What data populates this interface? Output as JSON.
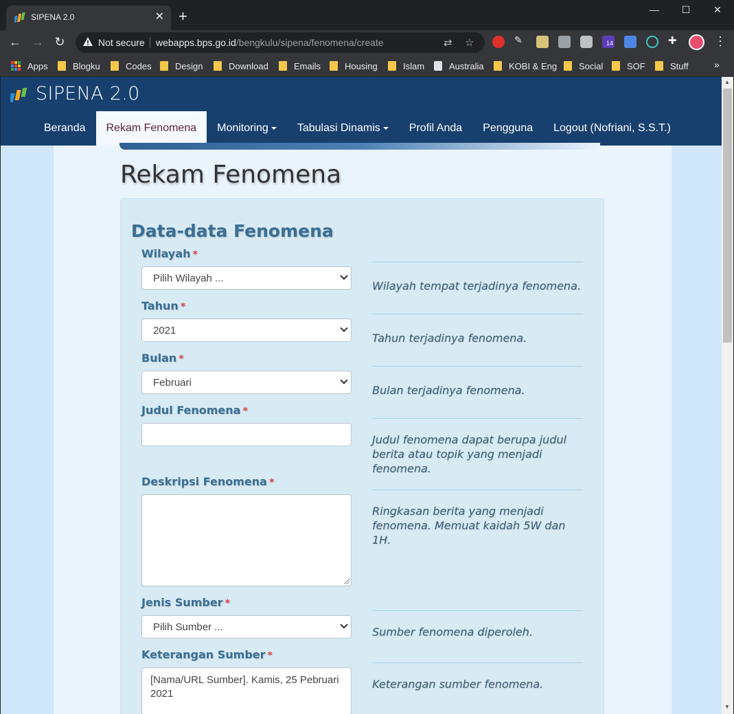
{
  "browser": {
    "tab_title": "SIPENA 2.0",
    "not_secure": "Not secure",
    "url_host": "webapps.bps.go.id",
    "url_path": "/bengkulu/sipena/fenomena/create",
    "ext_badge": "14",
    "bookmarks": [
      {
        "label": "Apps"
      },
      {
        "label": "Blogku"
      },
      {
        "label": "Codes"
      },
      {
        "label": "Design"
      },
      {
        "label": "Download"
      },
      {
        "label": "Emails"
      },
      {
        "label": "Housing"
      },
      {
        "label": "Islam"
      },
      {
        "label": "Australia"
      },
      {
        "label": "KOBI & Eng"
      },
      {
        "label": "Social"
      },
      {
        "label": "SOF"
      },
      {
        "label": "Stuff"
      }
    ]
  },
  "site": {
    "brand": "SIPENA 2.0",
    "nav": [
      {
        "label": "Beranda"
      },
      {
        "label": "Rekam Fenomena"
      },
      {
        "label": "Monitoring"
      },
      {
        "label": "Tabulasi Dinamis"
      },
      {
        "label": "Profil Anda"
      },
      {
        "label": "Pengguna"
      },
      {
        "label": "Logout (Nofriani, S.S.T.)"
      }
    ]
  },
  "page": {
    "title": "Rekam Fenomena",
    "section_title": "Data-data Fenomena",
    "required_mark": "*"
  },
  "form": {
    "wilayah": {
      "label": "Wilayah",
      "value": "Pilih Wilayah ...",
      "help": "Wilayah tempat terjadinya fenomena."
    },
    "tahun": {
      "label": "Tahun",
      "value": "2021",
      "help": "Tahun terjadinya fenomena."
    },
    "bulan": {
      "label": "Bulan",
      "value": "Februari",
      "help": "Bulan terjadinya fenomena."
    },
    "judul": {
      "label": "Judul Fenomena",
      "value": "",
      "help": "Judul fenomena dapat berupa judul berita atau topik yang menjadi fenomena."
    },
    "deskripsi": {
      "label": "Deskripsi Fenomena",
      "value": "",
      "help": "Ringkasan berita yang menjadi fenomena. Memuat kaidah 5W dan 1H."
    },
    "jenis_sumber": {
      "label": "Jenis Sumber",
      "value": "Pilih Sumber ...",
      "help": "Sumber fenomena diperoleh."
    },
    "keterangan_sumber": {
      "label": "Keterangan Sumber",
      "value": "[Nama/URL Sumber]. Kamis, 25 Pebruari 2021",
      "help": "Keterangan sumber fenomena."
    }
  }
}
